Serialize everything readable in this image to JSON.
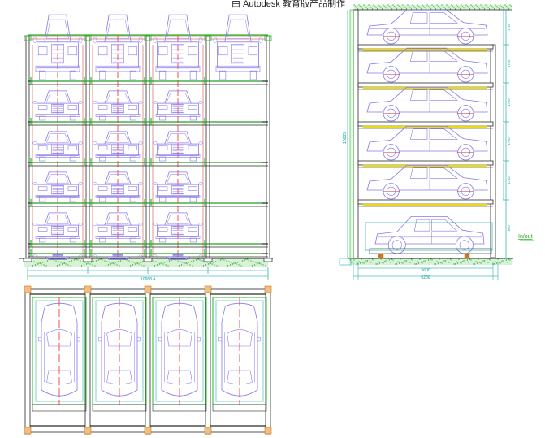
{
  "watermark": "由 Autodesk 教育版产品制作",
  "front_elevation": {
    "columns": 4,
    "levels": 6,
    "dims": {
      "total_width": "10688.4"
    }
  },
  "side_elevation": {
    "levels": 6,
    "label_in_out": "In/out",
    "dims": {
      "depth_inner": "5600",
      "depth_total": "6200",
      "height_total": "10685"
    },
    "level_heights": [
      "1750",
      "1750",
      "1750",
      "1750",
      "1750",
      "1650"
    ]
  },
  "plan_view": {
    "bays": 4
  },
  "colors": {
    "frame": "#2a2a2a",
    "car": "#8878e8",
    "green": "#22bb22",
    "red": "#ff2222",
    "yellow": "#e8d820",
    "dim": "#00a0a0",
    "ground": "#6cd06c",
    "orange": "#c87820"
  }
}
